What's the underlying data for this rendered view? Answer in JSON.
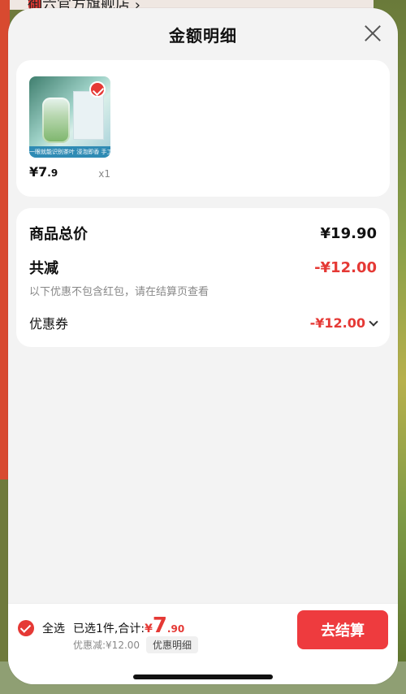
{
  "background": {
    "top_store_name": "御六官方旗舰店 ›"
  },
  "modal": {
    "title": "金额明细"
  },
  "product": {
    "price_main": "¥7",
    "price_decimal": ".9",
    "qty": "x1",
    "image_strip_text": "一眼就能识别茶叶 浸泡即香 手工瓦片"
  },
  "summary": {
    "total_label": "商品总价",
    "total_amount": "¥19.90",
    "reduce_label": "共减",
    "reduce_amount": "-¥12.00",
    "note": "以下优惠不包含红包，请在结算页查看",
    "coupon_label": "优惠券",
    "coupon_amount": "-¥12.00"
  },
  "bottom": {
    "select_all": "全选",
    "selected_text": "已选1件,合计:",
    "total_prefix": "¥",
    "total_big": "7",
    "total_small": ".90",
    "discount_text": "优惠减:¥12.00",
    "detail_label": "优惠明细",
    "checkout_label": "去结算"
  },
  "colors": {
    "accent_red": "#e53935",
    "button_red": "#ee3b3e"
  },
  "icons": {
    "close": "close-icon",
    "check": "check-icon",
    "chevron": "chevron-down-icon"
  }
}
